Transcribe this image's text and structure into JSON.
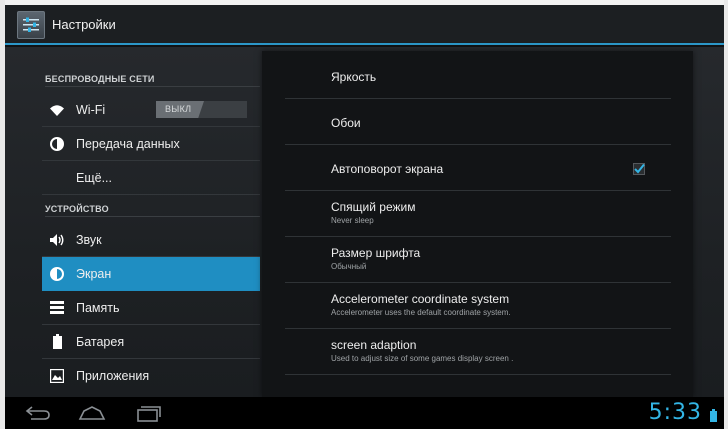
{
  "window": {
    "title": "Настройки",
    "accent_color": "#2c97c9",
    "selected_color": "#1f8ec2"
  },
  "sidebar": {
    "sections": [
      {
        "header": "БЕСПРОВОДНЫЕ СЕТИ",
        "items": [
          {
            "icon": "wifi-icon",
            "label": "Wi-Fi",
            "toggle": "ВЫКЛ"
          },
          {
            "icon": "data-usage-icon",
            "label": "Передача данных"
          },
          {
            "icon": null,
            "label": "Ещё..."
          }
        ]
      },
      {
        "header": "УСТРОЙСТВО",
        "items": [
          {
            "icon": "sound-icon",
            "label": "Звук"
          },
          {
            "icon": "display-icon",
            "label": "Экран",
            "selected": true
          },
          {
            "icon": "storage-icon",
            "label": "Память"
          },
          {
            "icon": "battery-icon",
            "label": "Батарея"
          },
          {
            "icon": "apps-icon",
            "label": "Приложения"
          }
        ]
      }
    ]
  },
  "main": {
    "prefs": [
      {
        "title": "Яркость"
      },
      {
        "title": "Обои"
      },
      {
        "title": "Автоповорот экрана",
        "checked": true
      },
      {
        "title": "Спящий режим",
        "summary": "Never sleep"
      },
      {
        "title": "Размер шрифта",
        "summary": "Обычный"
      },
      {
        "title": "Accelerometer coordinate system",
        "summary": "Accelerometer uses the default coordinate system."
      },
      {
        "title": "screen adaption",
        "summary": "Used to adjust size of some games display screen ."
      }
    ]
  },
  "systembar": {
    "clock": "5:33",
    "clock_color": "#33b5e5"
  }
}
